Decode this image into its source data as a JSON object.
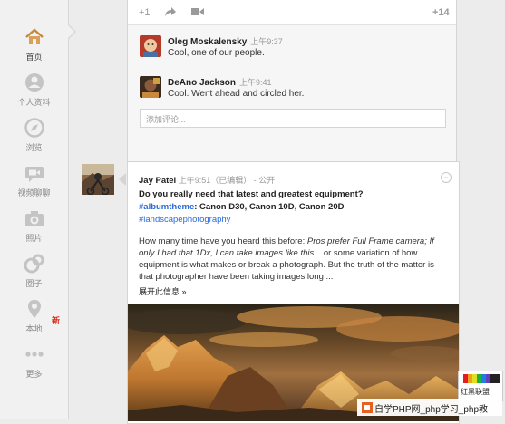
{
  "nav": {
    "items": [
      {
        "label": "首页",
        "icon": "home-icon"
      },
      {
        "label": "个人资料",
        "icon": "profile-icon"
      },
      {
        "label": "浏览",
        "icon": "explore-compass-icon"
      },
      {
        "label": "视频聊聊",
        "icon": "hangout-video-icon"
      },
      {
        "label": "照片",
        "icon": "camera-icon"
      },
      {
        "label": "圈子",
        "icon": "circles-icon"
      },
      {
        "label": "本地",
        "icon": "location-pin-icon"
      },
      {
        "label": "更多",
        "icon": "more-dots-icon"
      }
    ],
    "new_badge": "新"
  },
  "top_post": {
    "actions": {
      "plus_one": "+1",
      "plus_count": "+14"
    },
    "comments": [
      {
        "author": "Oleg Moskalensky",
        "time": "上午9:37",
        "text": "Cool, one of our people."
      },
      {
        "author": "DeAno Jackson",
        "time": "上午9:41",
        "text": "Cool. Went ahead and circled her."
      }
    ],
    "comment_placeholder": "添加评论..."
  },
  "post": {
    "author": "Jay Patel",
    "time": "上午9:51（已编辑）",
    "separator": "-",
    "visibility": "公开",
    "menu_glyph": "⌄",
    "headline": "Do you really need that latest and greatest equipment?",
    "hashtag_album": "#albumtheme",
    "cameras": ": Canon D30, Canon 10D, Canon 20D",
    "hashtag_landscape": "#landscapephotography",
    "body_lead": "How many time have you heard this before: ",
    "body_italic_1": "Pros prefer Full Frame camera; If",
    "body_italic_2": "only I had that 1Dx, I can take images like this",
    "body_line2_rest": "  ...or some variation of how",
    "body_line3": "equipment is what makes or break a photograph. But the truth of the matter is",
    "body_line4": "that photographer have been taking images long ...",
    "expand": "展开此信息 »"
  },
  "watermark": {
    "text": "自学PHP网_php学习_php教",
    "logo_text": "红黑联盟"
  },
  "colors": {
    "link": "#2a6ad8",
    "new_badge": "#dd2a1e",
    "sidebar_bg": "#f1f1f1",
    "page_bg": "#ececec"
  }
}
